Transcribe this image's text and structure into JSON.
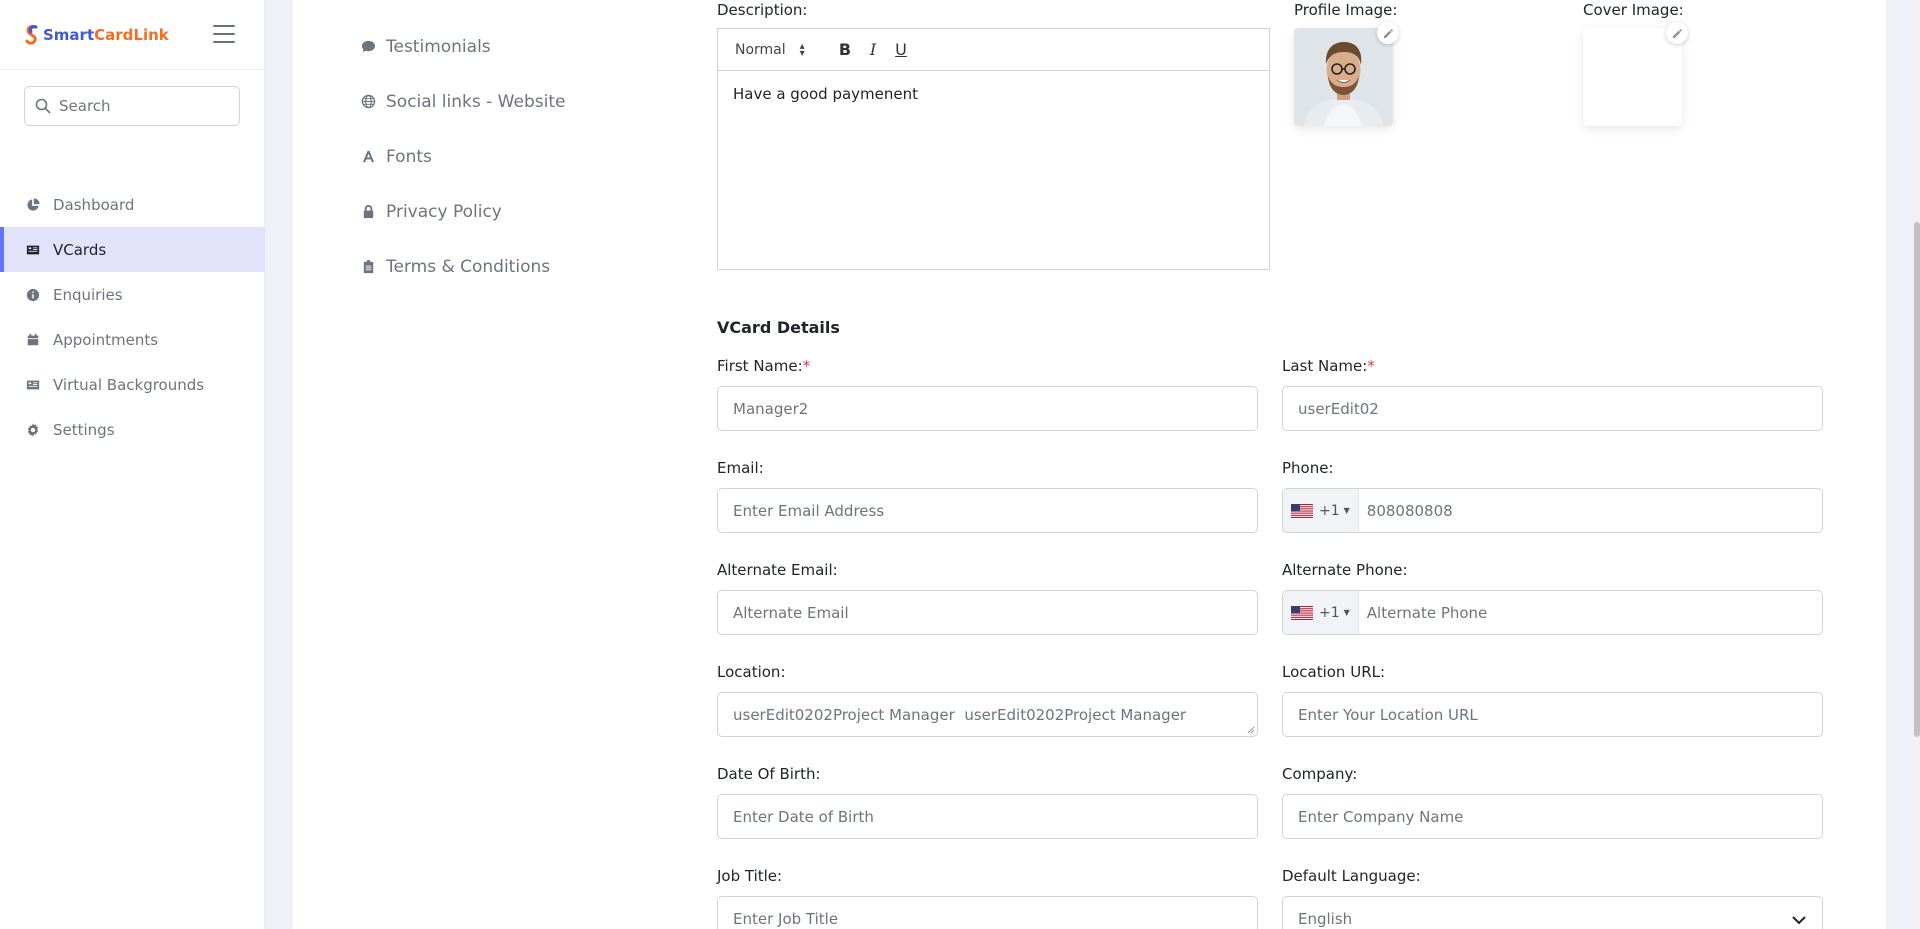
{
  "brand": {
    "smart": "Smart",
    "card": "Card",
    "link": "Link"
  },
  "search": {
    "placeholder": "Search"
  },
  "sidebar": {
    "items": [
      {
        "label": "Dashboard",
        "icon": "pie-chart-icon"
      },
      {
        "label": "VCards",
        "icon": "id-card-icon",
        "active": true
      },
      {
        "label": "Enquiries",
        "icon": "info-icon"
      },
      {
        "label": "Appointments",
        "icon": "calendar-icon"
      },
      {
        "label": "Virtual Backgrounds",
        "icon": "id-card-icon"
      },
      {
        "label": "Settings",
        "icon": "gear-icon"
      }
    ]
  },
  "tabs": [
    {
      "label": "Testimonials",
      "icon": "comment-icon"
    },
    {
      "label": "Social links - Website",
      "icon": "globe-icon"
    },
    {
      "label": "Fonts",
      "icon": "font-icon"
    },
    {
      "label": "Privacy Policy",
      "icon": "lock-icon"
    },
    {
      "label": "Terms & Conditions",
      "icon": "clipboard-icon"
    }
  ],
  "form": {
    "description_label": "Description:",
    "editor": {
      "size": "Normal",
      "bold": "B",
      "italic": "I",
      "underline": "U",
      "content": "Have a good paymenent"
    },
    "profile_image_label": "Profile Image:",
    "cover_image_label": "Cover Image:",
    "section_title": "VCard Details",
    "first_name": {
      "label": "First Name:",
      "required": "*",
      "value": "Manager2"
    },
    "last_name": {
      "label": "Last Name:",
      "required": "*",
      "value": "userEdit02"
    },
    "email": {
      "label": "Email:",
      "placeholder": "Enter Email Address"
    },
    "phone": {
      "label": "Phone:",
      "code": "+1",
      "value": "808080808"
    },
    "alt_email": {
      "label": "Alternate Email:",
      "placeholder": "Alternate Email"
    },
    "alt_phone": {
      "label": "Alternate Phone:",
      "code": "+1",
      "placeholder": "Alternate Phone"
    },
    "location": {
      "label": "Location:",
      "value": "userEdit0202Project Manager  userEdit0202Project Manager"
    },
    "location_url": {
      "label": "Location URL:",
      "placeholder": "Enter Your Location URL"
    },
    "dob": {
      "label": "Date Of Birth:",
      "placeholder": "Enter Date of Birth"
    },
    "company": {
      "label": "Company:",
      "placeholder": "Enter Company Name"
    },
    "job_title": {
      "label": "Job Title:",
      "placeholder": "Enter Job Title"
    },
    "default_language": {
      "label": "Default Language:",
      "value": "English"
    }
  },
  "colors": {
    "accent": "#6571ff",
    "active_bg": "#e2e3fb",
    "required": "#dc3545"
  }
}
